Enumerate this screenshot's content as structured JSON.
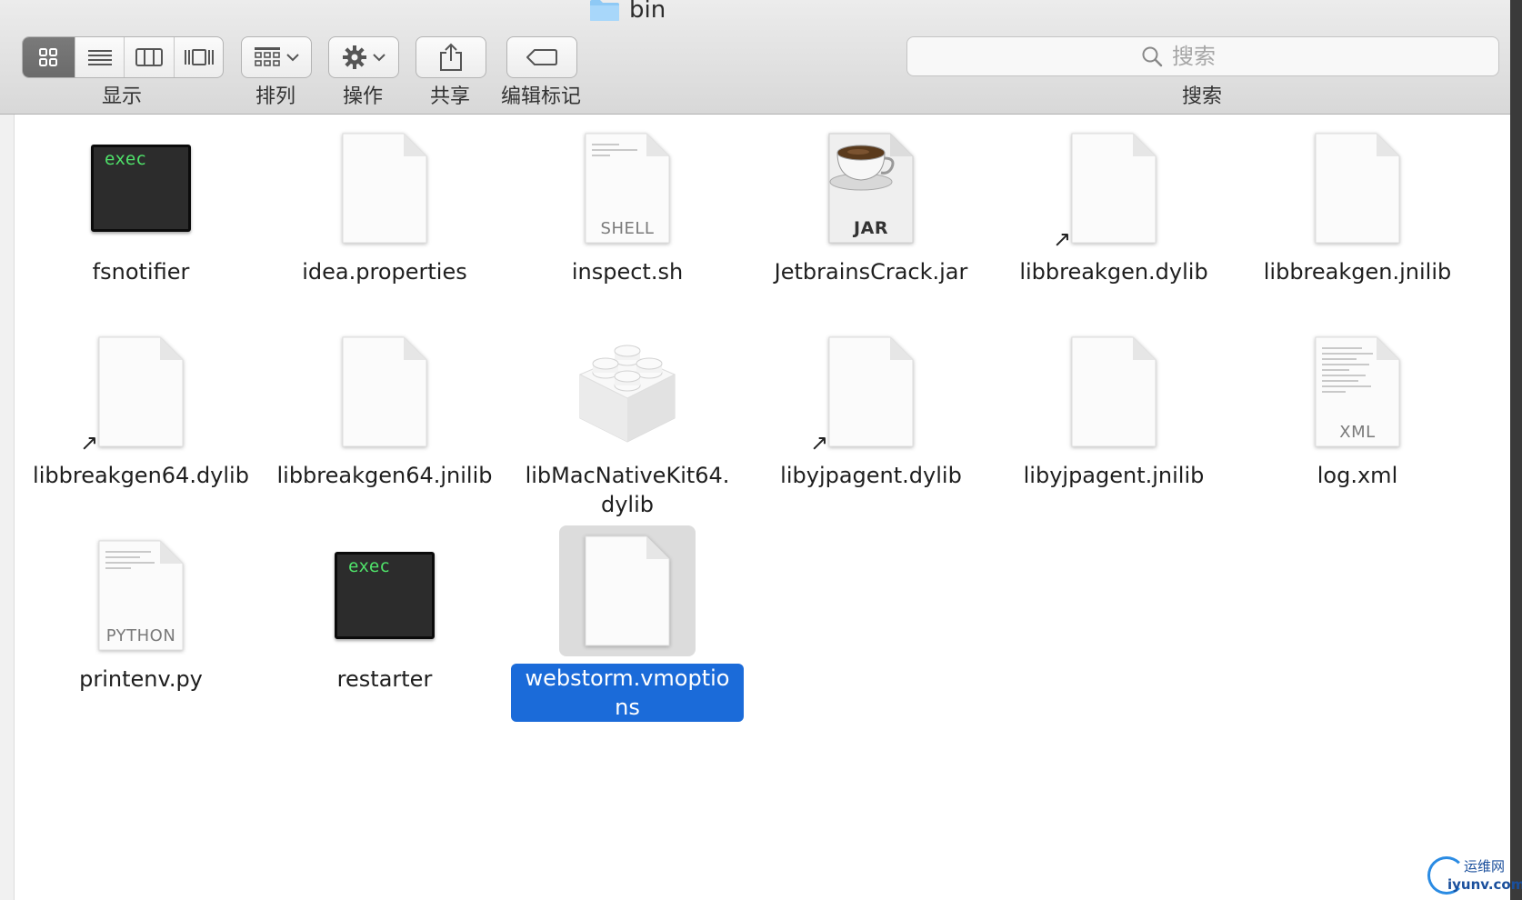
{
  "window": {
    "title": "bin",
    "folder_icon": "folder-icon"
  },
  "toolbar": {
    "view_label": "显示",
    "arrange_label": "排列",
    "action_label": "操作",
    "share_label": "共享",
    "tags_label": "编辑标记",
    "search_label": "搜索",
    "active_view": "icon"
  },
  "search": {
    "placeholder": "搜索"
  },
  "files": [
    {
      "name": "fsnotifier",
      "kind": "exec",
      "icon_text": "exec"
    },
    {
      "name": "idea.properties",
      "kind": "document"
    },
    {
      "name": "inspect.sh",
      "kind": "shell",
      "icon_text": "SHELL"
    },
    {
      "name": "JetbrainsCrack.jar",
      "kind": "jar",
      "icon_text": "JAR"
    },
    {
      "name": "libbreakgen.dylib",
      "kind": "alias-document"
    },
    {
      "name": "libbreakgen.jnilib",
      "kind": "document"
    },
    {
      "name": "libbreakgen64.dylib",
      "kind": "alias-document"
    },
    {
      "name": "libbreakgen64.jnilib",
      "kind": "document"
    },
    {
      "name": "libMacNativeKit64.\ndylib",
      "kind": "bundle"
    },
    {
      "name": "libyjpagent.dylib",
      "kind": "alias-document"
    },
    {
      "name": "libyjpagent.jnilib",
      "kind": "document"
    },
    {
      "name": "log.xml",
      "kind": "xml",
      "icon_text": "XML"
    },
    {
      "name": "printenv.py",
      "kind": "python",
      "icon_text": "PYTHON"
    },
    {
      "name": "restarter",
      "kind": "exec",
      "icon_text": "exec"
    },
    {
      "name": "webstorm.vmoptions",
      "kind": "document",
      "selected": true
    }
  ],
  "watermark": {
    "line1": "运维网",
    "line2": "iyunv.com"
  },
  "colors": {
    "selection": "#1b6bd9",
    "exec_text": "#4fe36a",
    "toolbar_bg": "#e2e2e2"
  }
}
